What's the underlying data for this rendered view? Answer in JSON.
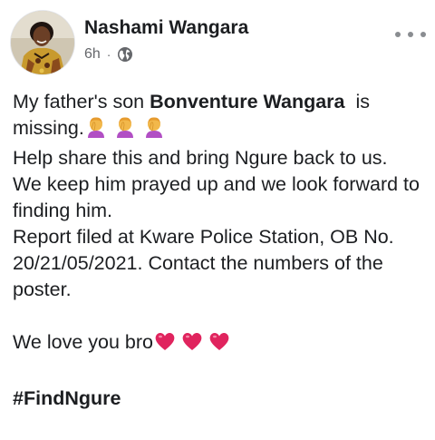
{
  "post": {
    "author_name": "Nashami Wangara",
    "timestamp": "6h",
    "meta_separator": "·",
    "audience_icon": "globe-icon",
    "more_icon": "more-horizontal-icon",
    "body": {
      "line1_prefix": "My father's son ",
      "line1_bold_name": "Bonventure Wangara",
      "line1_suffix": "  is missing.",
      "line1_emoji": [
        "woman-facepalming-emoji",
        "woman-facepalming-emoji",
        "woman-facepalming-emoji"
      ],
      "line2": "Help share this and bring Ngure back to us.",
      "line3": "We keep him prayed up and we look forward to finding him.",
      "line4": "Report filed at  Kware Police Station, OB No. 20/21/05/2021. Contact the numbers of the poster.",
      "line5": "We love you bro",
      "line5_emoji": [
        "red-heart-emoji",
        "red-heart-emoji",
        "red-heart-emoji"
      ],
      "hashtag": "#FindNgure"
    }
  },
  "colors": {
    "text_primary": "#1c1e21",
    "text_secondary": "#65676b",
    "heart_red": "#e0245e",
    "emoji_skin": "#f2b84b",
    "emoji_shirt": "#b14fc4"
  }
}
